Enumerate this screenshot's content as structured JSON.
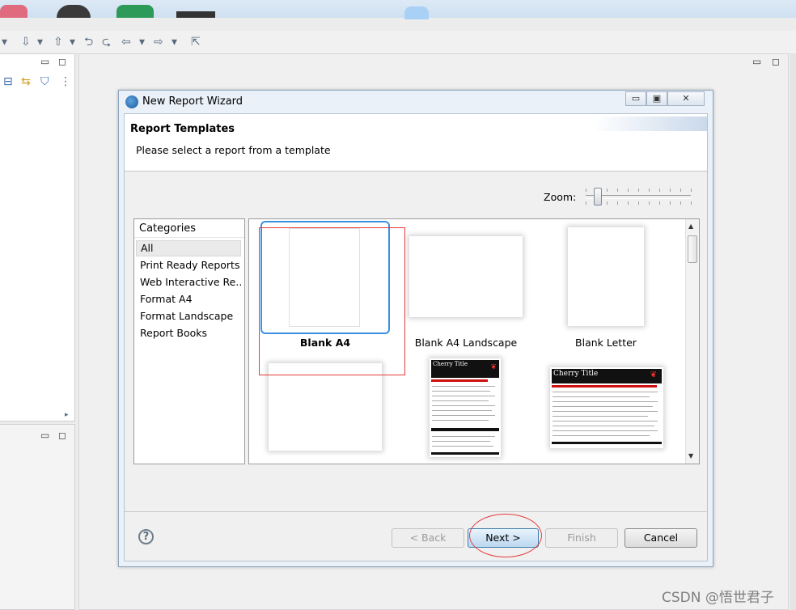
{
  "dialog": {
    "title": "New Report Wizard",
    "window_buttons": {
      "minimize": "▭",
      "maximize": "▣",
      "close": "✕"
    },
    "header": {
      "title": "Report Templates",
      "description": "Please select a report from a template"
    },
    "zoom": {
      "label": "Zoom:",
      "level": 0.1
    },
    "categories": {
      "header": "Categories",
      "items": [
        "All",
        "Print Ready Reports",
        "Web Interactive Re...",
        "Format A4",
        "Format Landscape",
        "Report Books"
      ],
      "selected": "All"
    },
    "templates": {
      "items": [
        {
          "label": "Blank A4",
          "selected": true
        },
        {
          "label": "Blank A4 Landscape",
          "selected": false
        },
        {
          "label": "Blank Letter",
          "selected": false
        },
        {
          "label": "",
          "selected": false
        },
        {
          "label": "",
          "selected": false,
          "preview_title": "Cherry Title"
        },
        {
          "label": "",
          "selected": false,
          "preview_title": "Cherry Title"
        }
      ]
    },
    "buttons": {
      "help": "?",
      "back": "< Back",
      "next": "Next >",
      "finish": "Finish",
      "cancel": "Cancel"
    }
  },
  "annotation_colors": {
    "highlight": "#e53a3a",
    "selection": "#3b91e0"
  },
  "watermark": "CSDN @悟世君子"
}
